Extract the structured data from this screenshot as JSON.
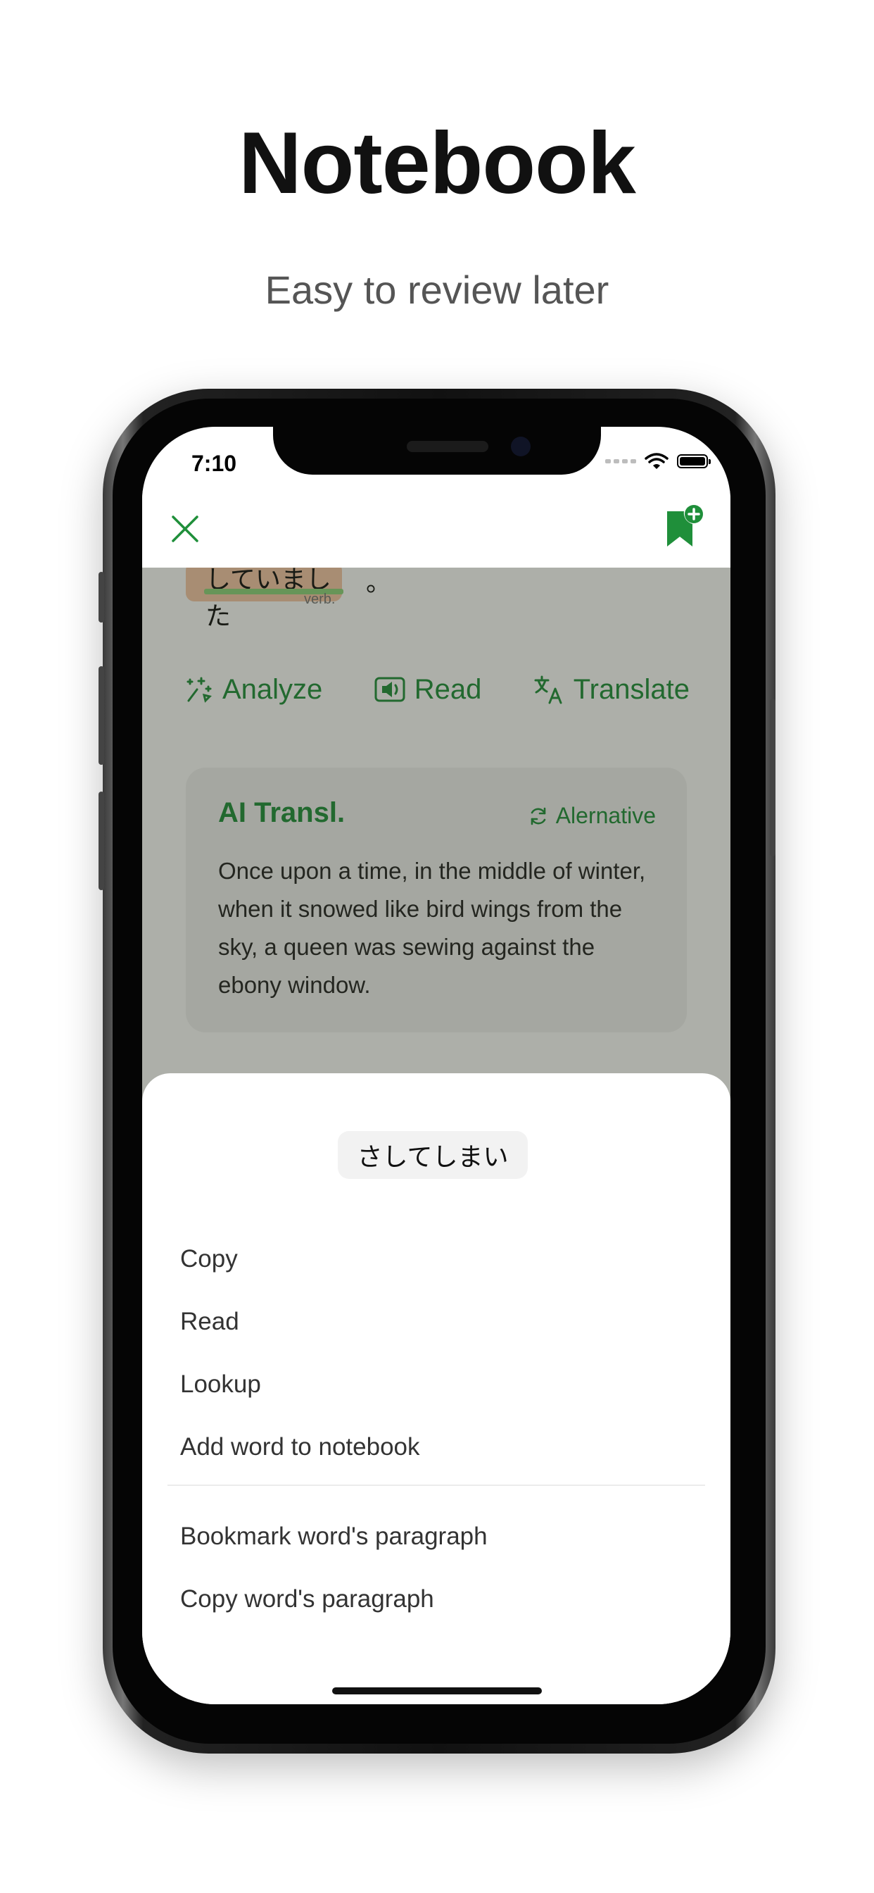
{
  "promo": {
    "title": "Notebook",
    "subtitle": "Easy to review later"
  },
  "status_bar": {
    "time": "7:10"
  },
  "reader": {
    "token": {
      "text": "していました",
      "punctuation": "。",
      "part_of_speech": "verb."
    },
    "actions": [
      {
        "label": "Analyze",
        "icon": "sparkle-icon"
      },
      {
        "label": "Read",
        "icon": "speaker-icon"
      },
      {
        "label": "Translate",
        "icon": "translate-icon"
      }
    ],
    "translation_card": {
      "title": "AI Transl.",
      "alternative_label": "Alernative",
      "text": "Once upon a time, in the middle of winter, when it snowed like bird wings from the sky, a queen was sewing against the ebony window."
    }
  },
  "sheet": {
    "selected_word": "さしてしまい",
    "items": [
      "Copy",
      "Read",
      "Lookup",
      "Add word to notebook"
    ],
    "paragraph_items": [
      "Bookmark word's paragraph",
      "Copy word's paragraph"
    ]
  },
  "colors": {
    "accent": "#1f8f3a",
    "token_highlight": "#f7c9a8",
    "underline": "#8fd57d"
  }
}
